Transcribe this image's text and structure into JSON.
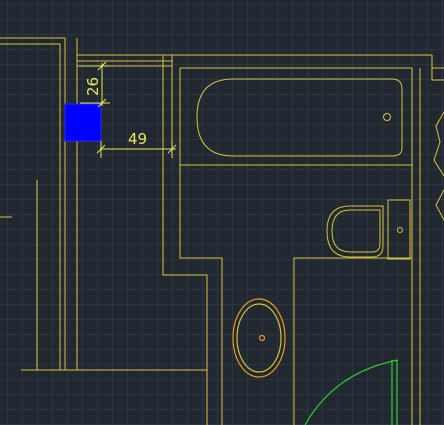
{
  "viewport": {
    "grid_color": "#2c3541",
    "background_color": "#212830"
  },
  "colors": {
    "linework": "#d6c23e",
    "dimension": "#e8e858",
    "selection_fill": "#0000ff",
    "door_swing": "#2fcc2f"
  },
  "dimensions": {
    "vertical": {
      "value": "26"
    },
    "horizontal": {
      "value": "49"
    }
  },
  "fixtures": [
    "bathtub",
    "toilet",
    "sink",
    "door"
  ],
  "selection": {
    "type": "solid-hatch"
  }
}
